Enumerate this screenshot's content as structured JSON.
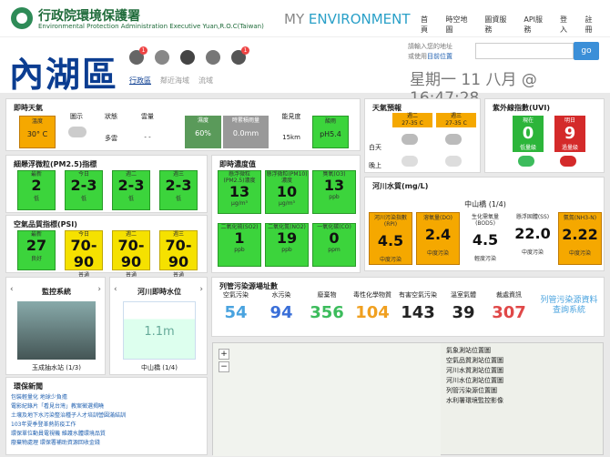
{
  "header": {
    "org_zh": "行政院環境保護署",
    "org_en": "Environmental Protection Administration Executive Yuan,R.O.C(Taiwan)",
    "my": "MY",
    "env": "ENVIRONMENT",
    "nav": [
      "首頁",
      "時空地圖",
      "圖資服務",
      "API服務",
      "登入",
      "註冊"
    ]
  },
  "location": {
    "city": "內湖區",
    "tabs": [
      "行政區",
      "鄰近海域",
      "流域"
    ],
    "icon_badges": [
      "1",
      "",
      "",
      "",
      "1"
    ],
    "req1": "請輸入您的地址",
    "req2": "或使用",
    "req2_link": "目前位置",
    "go": "go",
    "date": "星期一 11 八月 @ 16:47:28"
  },
  "weather_now": {
    "title": "即時天氣",
    "headers": [
      "溫度",
      "圖示",
      "狀態",
      "雲量",
      "濕度",
      "時累積雨量",
      "能見度",
      "酸雨"
    ],
    "temp": "30° C",
    "status": "多雲",
    "cloud": "- -",
    "humidity": "60%",
    "rain": "0.0mm",
    "vis": "15km",
    "acid": "pH5.4"
  },
  "forecast": {
    "title": "天氣預報",
    "days": [
      "週二",
      "週三"
    ],
    "temps": [
      "27-35 C",
      "27-35 C"
    ],
    "rows": [
      "白天",
      "晚上"
    ]
  },
  "uv": {
    "title": "紫外線指數(UVI)",
    "now": {
      "label": "現在",
      "value": "0",
      "level": "低量級"
    },
    "tomorrow": {
      "label": "明日",
      "value": "9",
      "level": "過量級"
    }
  },
  "pm25": {
    "title": "細懸浮微粒(PM2.5)指標",
    "cells": [
      {
        "label": "最新",
        "value": "2",
        "level": "低"
      },
      {
        "label": "今日",
        "value": "2-3",
        "level": "低"
      },
      {
        "label": "週二",
        "value": "2-3",
        "level": "低"
      },
      {
        "label": "週三",
        "value": "2-3",
        "level": "低"
      }
    ]
  },
  "psi": {
    "title": "空氣品質指標(PSI)",
    "cells": [
      {
        "label": "最新",
        "value": "27",
        "level": "良好"
      },
      {
        "label": "今日",
        "value": "70-90",
        "level": "普通"
      },
      {
        "label": "週二",
        "value": "70-90",
        "level": "普通"
      },
      {
        "label": "週三",
        "value": "70-90",
        "level": "普通"
      }
    ]
  },
  "conc": {
    "title": "即時濃度值",
    "top": [
      {
        "label": "懸浮微粒(PM2.5)濃度",
        "value": "13",
        "unit": "μg/m³"
      },
      {
        "label": "懸浮微粒(PM10)濃度",
        "value": "10",
        "unit": "μg/m³"
      },
      {
        "label": "臭氧(O3)",
        "value": "13",
        "unit": "ppb"
      }
    ],
    "bottom": [
      {
        "label": "二氧化硫(SO2)",
        "value": "1",
        "unit": "ppb"
      },
      {
        "label": "二氧化氮(NO2)",
        "value": "19",
        "unit": "ppb"
      },
      {
        "label": "一氧化碳(CO)",
        "value": "0",
        "unit": "ppm"
      }
    ]
  },
  "river": {
    "title": "河川水質(mg/L)",
    "station": "中山橋 (1/4)",
    "cells": [
      {
        "label": "河川污染指數(RPI)",
        "value": "4.5",
        "level": "中度污染"
      },
      {
        "label": "溶氧量(DO)",
        "value": "2.4",
        "level": "中度污染"
      },
      {
        "label": "生化需氧量(BOD5)",
        "value": "4.5",
        "level": "輕度污染"
      },
      {
        "label": "懸浮固體(SS)",
        "value": "22.0",
        "level": "中度污染"
      },
      {
        "label": "氨氮(NH3-N)",
        "value": "2.22",
        "level": "中度污染"
      }
    ]
  },
  "monitor": {
    "title": "監控系統",
    "caption": "玉成抽水站 (1/3)"
  },
  "level": {
    "title": "河川即時水位",
    "value": "1.1m",
    "caption": "中山橋 (1/4)"
  },
  "pollution": {
    "title": "列管污染源場址數",
    "items": [
      {
        "label": "空氣污染",
        "value": "54",
        "color": "#4aa3df"
      },
      {
        "label": "水污染",
        "value": "94",
        "color": "#3a6fd8"
      },
      {
        "label": "廢棄物",
        "value": "356",
        "color": "#3cbc5c"
      },
      {
        "label": "毒性化學物質",
        "value": "104",
        "color": "#f0a020"
      },
      {
        "label": "有害空氣污染",
        "value": "143",
        "color": "#222222"
      },
      {
        "label": "溫室氣體",
        "value": "39",
        "color": "#222222"
      },
      {
        "label": "裁處資訊",
        "value": "307",
        "color": "#e04848"
      }
    ],
    "link": "列管污染源資料查詢系統"
  },
  "map_layers": [
    "氣象測站位置圖",
    "空氣品質測站位置圖",
    "河川水質測站位置圖",
    "河川水位測站位置圖",
    "列管污染源位置圖",
    "水利署環境監控影像"
  ],
  "news": {
    "title": "環保新聞",
    "items": [
      "包裝輕量化 地球少負擔",
      "電影紀錄片「看見台灣」教案徵選揭曉",
      "土壤及地下水污染整治種子人才培訓營圓滿結訓",
      "103年夏季登革熱防疫工作",
      "環保單位動員電視機 維護水體環境品質",
      "廢棄物處理 環保署補助資源回收金錢"
    ]
  }
}
